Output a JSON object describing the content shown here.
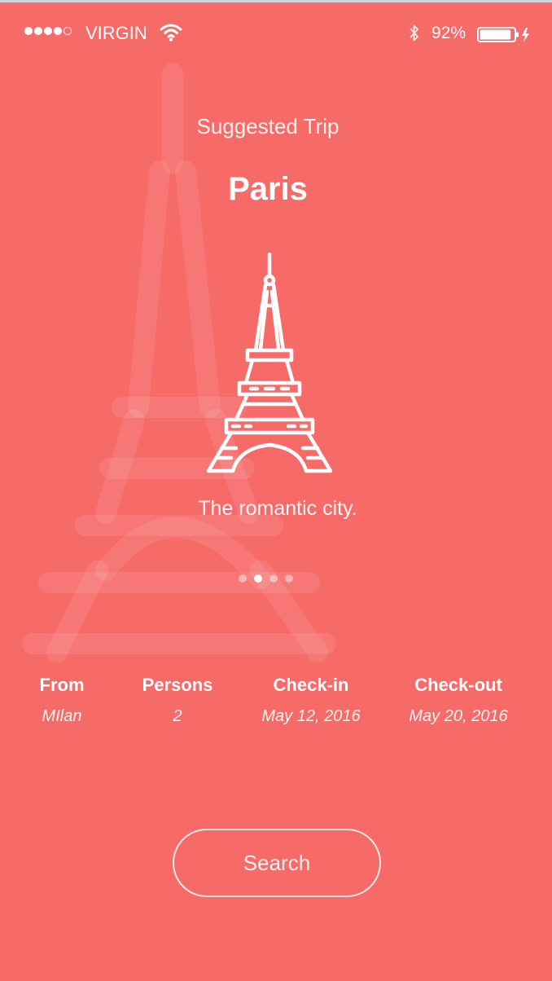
{
  "status_bar": {
    "signal_filled": 4,
    "signal_total": 5,
    "carrier": "VIRGIN",
    "battery_percent": "92%",
    "battery_level": 0.92
  },
  "header": {
    "subtitle": "Suggested Trip",
    "title": "Paris"
  },
  "hero": {
    "icon": "eiffel-tower-icon",
    "tagline": "The romantic city."
  },
  "pager": {
    "count": 4,
    "active_index": 1
  },
  "trip": {
    "from_label": "From",
    "from_value": "MIlan",
    "persons_label": "Persons",
    "persons_value": "2",
    "checkin_label": "Check-in",
    "checkin_value": "May 12, 2016",
    "checkout_label": "Check-out",
    "checkout_value": "May 20, 2016"
  },
  "actions": {
    "search_label": "Search"
  },
  "colors": {
    "background": "#f66a68",
    "foreground": "#ffffff"
  }
}
